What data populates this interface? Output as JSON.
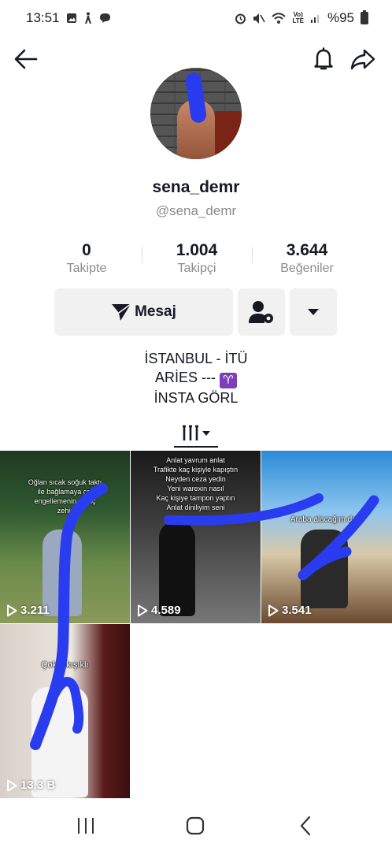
{
  "status_bar": {
    "time": "13:51",
    "battery_percent": "%95",
    "left_icons": [
      "gallery-icon",
      "walking-icon",
      "chat-icon"
    ],
    "right_icons": [
      "alarm-icon",
      "mute-icon",
      "wifi-icon",
      "volte-icon",
      "signal-icon",
      "battery-icon"
    ]
  },
  "header": {
    "back_icon": "arrow-left-icon",
    "bell_icon": "bell-icon",
    "share_icon": "share-arrow-icon"
  },
  "profile": {
    "display_name": "sena_demr",
    "handle": "@sena_demr"
  },
  "stats": [
    {
      "value": "0",
      "label": "Takipte"
    },
    {
      "value": "1.004",
      "label": "Takipçi"
    },
    {
      "value": "3.644",
      "label": "Beğeniler"
    }
  ],
  "actions": {
    "message_label": "Mesaj",
    "message_icon": "send-icon",
    "add_user_icon": "user-settings-icon",
    "more_icon": "caret-down-icon"
  },
  "bio": {
    "line1": "İSTANBUL - İTÜ",
    "line2": "ARİES --- ",
    "line2_emoji": "♈",
    "line3": "İNSTA GÖRL"
  },
  "tabs": {
    "videos_icon": "grid-lines-icon"
  },
  "videos": [
    {
      "plays": "3.211",
      "caption": [
        "Oğlan sıcak soğuk taktı",
        "ile bağlamaya çal",
        "engellemenin",
        "güç",
        "zehir"
      ]
    },
    {
      "plays": "4.589",
      "caption": [
        "Anlat yavrum anlat",
        "Trafikte kaç kişiyle kapıştın",
        "Neyden ceza yedin",
        "Yeni warexin nasıl",
        "Kaç kişiye tampon yaptın",
        "Anlat diniliyim seni"
      ]
    },
    {
      "plays": "3.541",
      "caption": [
        "Araba alacağım derk"
      ]
    },
    {
      "plays": "13,3 B",
      "caption": [
        "Çok",
        "akışıklı"
      ]
    }
  ],
  "nav": {
    "recents_icon": "recents-icon",
    "home_icon": "home-icon",
    "back_icon": "back-chevron-icon"
  },
  "colors": {
    "text": "#161823",
    "secondary_text": "#8a8b91",
    "button_bg": "#f1f1f2",
    "scribble": "#2a3cf0"
  }
}
